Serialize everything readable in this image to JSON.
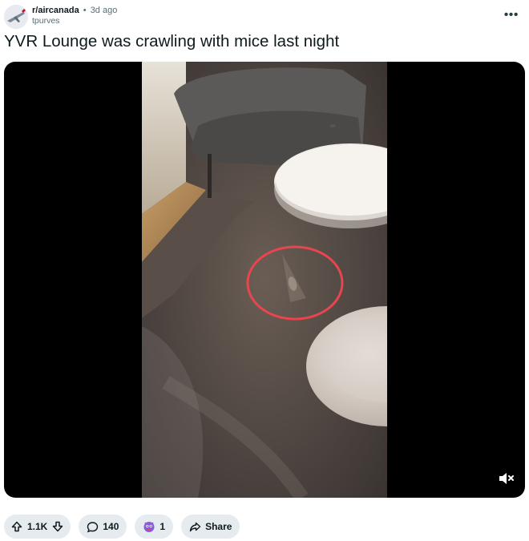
{
  "post": {
    "subreddit": "r/aircanada",
    "separator": "•",
    "time_ago": "3d ago",
    "author": "tpurves",
    "title": "YVR Lounge was crawling with mice last night"
  },
  "actions": {
    "upvote_count": "1.1K",
    "comment_count": "140",
    "award_count": "1",
    "share_label": "Share"
  },
  "icons": {
    "menu": "more-horizontal-icon",
    "mute": "speaker-muted-icon",
    "upvote": "arrow-up-icon",
    "downvote": "arrow-down-icon",
    "comment": "speech-bubble-icon",
    "award": "award-icon",
    "share": "share-arrow-icon"
  },
  "colors": {
    "pill_bg": "#e5ebee",
    "highlight_circle": "#e8454f",
    "text": "#0f1a1c",
    "muted_text": "#576f76"
  }
}
